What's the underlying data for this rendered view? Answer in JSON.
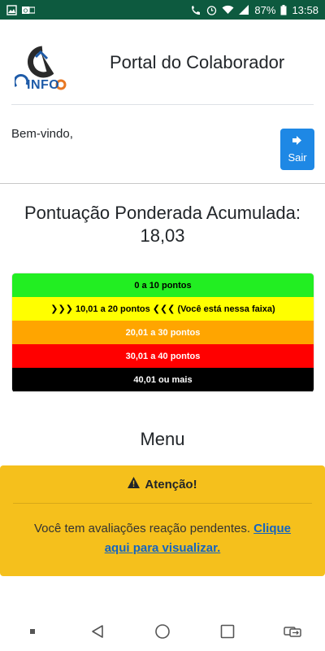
{
  "status_bar": {
    "time": "13:58",
    "battery": "87%",
    "left_icons": [
      "image-icon",
      "outlook-icon"
    ],
    "right_icons": [
      "wifi-call-icon",
      "alarm-icon",
      "wifi-icon",
      "signal-icon",
      "battery-icon"
    ]
  },
  "header": {
    "logo_text": "INFO",
    "title": "Portal do Colaborador"
  },
  "user": {
    "welcome": "Bem-vindo,",
    "logout_label": "Sair"
  },
  "score": {
    "heading": "Pontuação Ponderada Acumulada:",
    "value": "18,03"
  },
  "bands": [
    {
      "label": "0 a 10 pontos",
      "color": "#22ee22",
      "text_color": "#000000"
    },
    {
      "label": "❯❯❯ 10,01 a 20 pontos ❮❮❮  (Você está nessa faixa)",
      "color": "#ffff00",
      "text_color": "#000000"
    },
    {
      "label": "20,01 a 30 pontos",
      "color": "#ffa500",
      "text_color": "#ffffff"
    },
    {
      "label": "30,01 a 40 pontos",
      "color": "#ff0000",
      "text_color": "#ffffff"
    },
    {
      "label": "40,01 ou mais",
      "color": "#000000",
      "text_color": "#ffffff"
    }
  ],
  "menu": {
    "title": "Menu"
  },
  "alert": {
    "title": "Atenção!",
    "message": "Você tem avaliações reação pendentes. ",
    "link_text": "Clique aqui para visualizar."
  },
  "nav_bar": {
    "buttons": [
      "recent-dot-icon",
      "back-icon",
      "home-icon",
      "overview-icon",
      "switch-icon"
    ]
  },
  "colors": {
    "status_bar": "#0d5a3f",
    "logout_button": "#1e88e5",
    "alert_bg": "#f5c01c",
    "link": "#1565c0"
  }
}
